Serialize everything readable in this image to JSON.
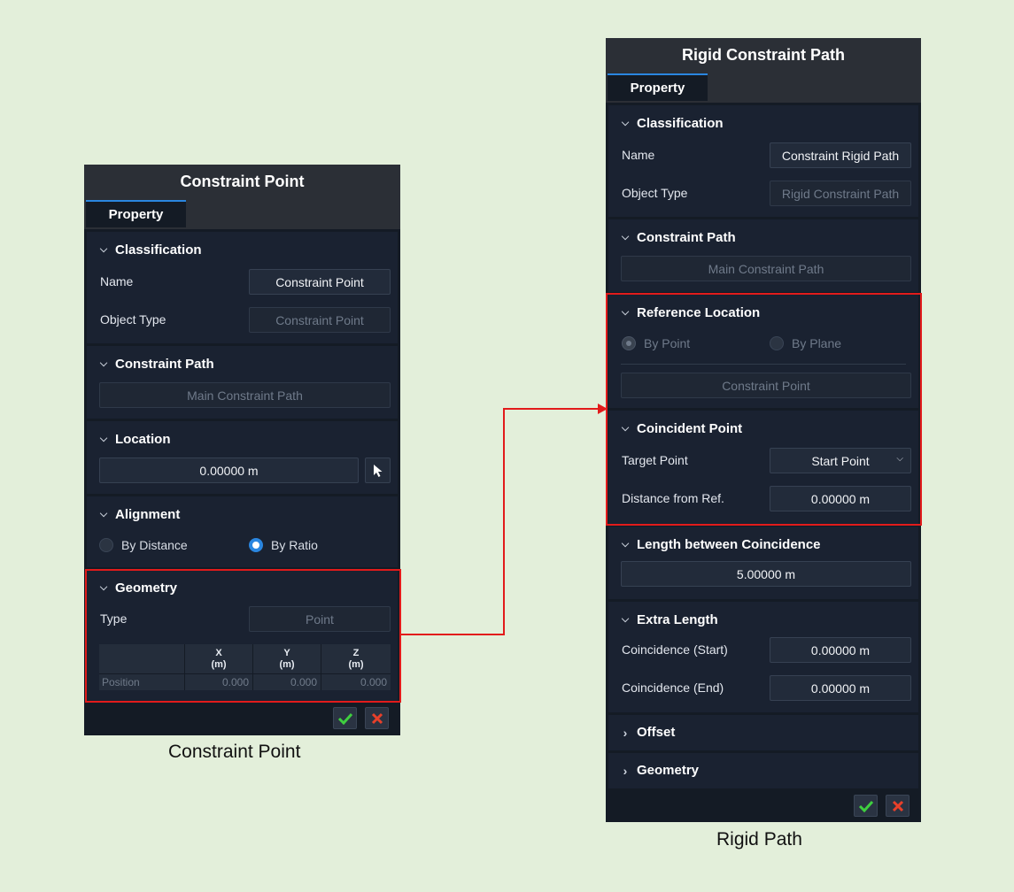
{
  "left_panel": {
    "title": "Constraint Point",
    "tab": "Property",
    "classification": {
      "header": "Classification",
      "name_label": "Name",
      "name_value": "Constraint Point",
      "object_type_label": "Object Type",
      "object_type_value": "Constraint Point"
    },
    "constraint_path": {
      "header": "Constraint Path",
      "value": "Main Constraint Path"
    },
    "location": {
      "header": "Location",
      "value": "0.00000 m"
    },
    "alignment": {
      "header": "Alignment",
      "option1": "By Distance",
      "option2": "By Ratio",
      "selected": "By Ratio"
    },
    "geometry": {
      "header": "Geometry",
      "type_label": "Type",
      "type_value": "Point",
      "columns": [
        {
          "axis": "X",
          "unit": "(m)"
        },
        {
          "axis": "Y",
          "unit": "(m)"
        },
        {
          "axis": "Z",
          "unit": "(m)"
        }
      ],
      "row_label": "Position",
      "row_values": [
        "0.000",
        "0.000",
        "0.000"
      ]
    },
    "caption": "Constraint Point"
  },
  "right_panel": {
    "title": "Rigid Constraint Path",
    "tab": "Property",
    "classification": {
      "header": "Classification",
      "name_label": "Name",
      "name_value": "Constraint Rigid Path",
      "object_type_label": "Object Type",
      "object_type_value": "Rigid Constraint Path"
    },
    "constraint_path": {
      "header": "Constraint Path",
      "value": "Main Constraint Path"
    },
    "reference_location": {
      "header": "Reference Location",
      "option1": "By Point",
      "option2": "By Plane",
      "selected": "By Point",
      "value": "Constraint Point"
    },
    "coincident_point": {
      "header": "Coincident Point",
      "target_label": "Target Point",
      "target_value": "Start Point",
      "distance_label": "Distance from Ref.",
      "distance_value": "0.00000 m"
    },
    "length_between": {
      "header": "Length between Coincidence",
      "value": "5.00000 m"
    },
    "extra_length": {
      "header": "Extra Length",
      "start_label": "Coincidence (Start)",
      "start_value": "0.00000 m",
      "end_label": "Coincidence (End)",
      "end_value": "0.00000 m"
    },
    "offset": {
      "header": "Offset"
    },
    "geometry": {
      "header": "Geometry"
    },
    "caption": "Rigid Path"
  },
  "colors": {
    "background": "#e3efda",
    "panel": "#141b25",
    "accent": "#2a86e0",
    "highlight": "#e21b1b",
    "ok": "#3fcf3f",
    "cancel": "#e8402a"
  },
  "icons": [
    "chevron-down-icon",
    "chevron-right-icon",
    "pointer-icon",
    "check-icon",
    "close-icon",
    "dropdown-arrow-icon"
  ]
}
